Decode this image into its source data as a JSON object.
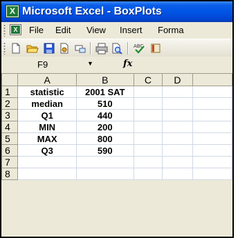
{
  "window": {
    "title": "Microsoft Excel - BoxPlots"
  },
  "menu": {
    "items": [
      "File",
      "Edit",
      "View",
      "Insert",
      "Forma"
    ]
  },
  "toolbar": {
    "icons": [
      "new-icon",
      "open-icon",
      "save-icon",
      "permission-icon",
      "print-icon",
      "print-preview-icon",
      "spelling-icon"
    ]
  },
  "formula_bar": {
    "cell_ref": "F9",
    "fx_label": "fx",
    "content": ""
  },
  "sheet": {
    "columns": [
      "A",
      "B",
      "C",
      "D"
    ],
    "rows": [
      {
        "num": "1",
        "cells": [
          "statistic",
          "2001 SAT",
          "",
          ""
        ]
      },
      {
        "num": "2",
        "cells": [
          "median",
          "510",
          "",
          ""
        ]
      },
      {
        "num": "3",
        "cells": [
          "Q1",
          "440",
          "",
          ""
        ]
      },
      {
        "num": "4",
        "cells": [
          "MIN",
          "200",
          "",
          ""
        ]
      },
      {
        "num": "5",
        "cells": [
          "MAX",
          "800",
          "",
          ""
        ]
      },
      {
        "num": "6",
        "cells": [
          "Q3",
          "590",
          "",
          ""
        ]
      },
      {
        "num": "7",
        "cells": [
          "",
          "",
          "",
          ""
        ]
      },
      {
        "num": "8",
        "cells": [
          "",
          "",
          "",
          ""
        ]
      }
    ]
  }
}
